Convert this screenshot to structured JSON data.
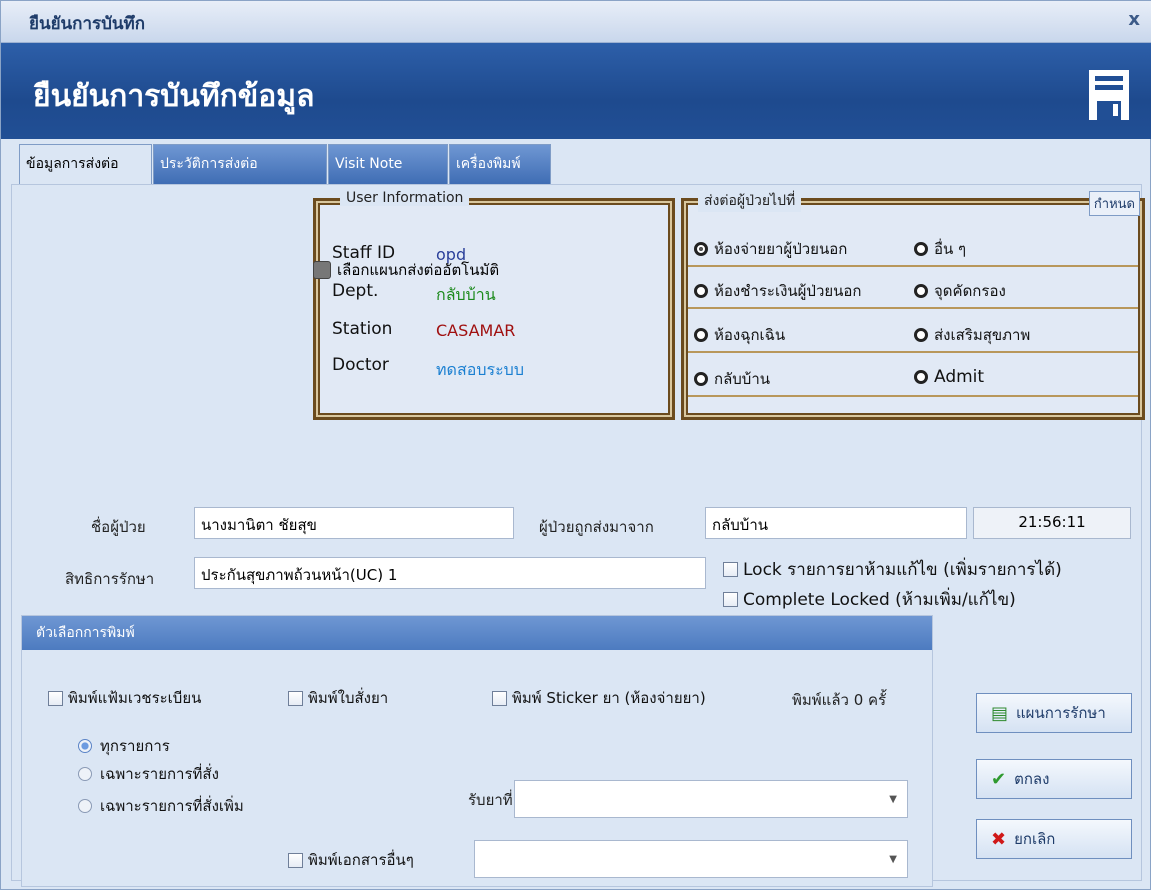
{
  "window": {
    "title": "ยืนยันการบันทึก",
    "close": "x"
  },
  "banner": {
    "heading": "ยืนยันการบันทึกข้อมูล",
    "icon": "save-disk-icon"
  },
  "tabs": [
    {
      "label": "ข้อมูลการส่งต่อ",
      "active": true
    },
    {
      "label": "ประวัติการส่งต่อ",
      "active": false
    },
    {
      "label": "Visit Note",
      "active": false
    },
    {
      "label": "เครื่องพิมพ์",
      "active": false
    }
  ],
  "user_info": {
    "legend": "User Information",
    "rows": [
      {
        "label": "Staff ID",
        "value": "opd",
        "color": "#2a3f9a"
      },
      {
        "label": "Dept.",
        "value": "กลับบ้าน",
        "color": "#1c8a1c"
      },
      {
        "label": "Station",
        "value": "CASAMAR",
        "color": "#a01010"
      },
      {
        "label": "Doctor",
        "value": "ทดสอบระบบ",
        "color": "#1a7fd1"
      }
    ]
  },
  "destination": {
    "legend": "ส่งต่อผู้ป่วยไปที่",
    "set_button": "กำหนด",
    "options": [
      {
        "label": "ห้องจ่ายยาผู้ป่วยนอก",
        "selected": true
      },
      {
        "label": "อื่น ๆ",
        "selected": false
      },
      {
        "label": "ห้องชำระเงินผู้ป่วยนอก",
        "selected": false
      },
      {
        "label": "จุดคัดกรอง",
        "selected": false
      },
      {
        "label": "ห้องฉุกเฉิน",
        "selected": false
      },
      {
        "label": "ส่งเสริมสุขภาพ",
        "selected": false
      },
      {
        "label": "กลับบ้าน",
        "selected": false
      },
      {
        "label": "Admit",
        "selected": false
      }
    ]
  },
  "auto_select": "เลือกแผนกส่งต่ออัตโนมัติ",
  "patient": {
    "name_label": "ชื่อผู้ป่วย",
    "name_value": "นางมานิตา ชัยสุข",
    "from_label": "ผู้ป่วยถูกส่งมาจาก",
    "from_value": "กลับบ้าน",
    "time": "21:56:11",
    "rights_label": "สิทธิการรักษา",
    "rights_value": "ประกันสุขภาพถ้วนหน้า(UC) 1"
  },
  "locks": {
    "lock_label": "Lock รายการยาห้ามแก้ไข (เพิ่มรายการได้)",
    "complete_label": "Complete Locked (ห้ามเพิ่ม/แก้ไข)"
  },
  "print_options": {
    "header": "ตัวเลือกการพิมพ์",
    "print_record": "พิมพ์แฟ้มเวชระเบียน",
    "print_order": "พิมพ์ใบสั่งยา",
    "print_sticker": "พิมพ์ Sticker ยา (ห้องจ่ายยา)",
    "printed_count": "พิมพ์แล้ว 0 ครั้",
    "scope": [
      {
        "label": "ทุกรายการ",
        "selected": true
      },
      {
        "label": "เฉพาะรายการที่สั่ง",
        "selected": false
      },
      {
        "label": "เฉพาะรายการที่สั่งเพิ่ม",
        "selected": false
      }
    ],
    "receive_label": "รับยาที่",
    "receive_value": "",
    "print_other": "พิมพ์เอกสารอื่นๆ",
    "other_value": ""
  },
  "buttons": {
    "plan": "แผนการรักษา",
    "ok": "ตกลง",
    "cancel": "ยกเลิก"
  }
}
